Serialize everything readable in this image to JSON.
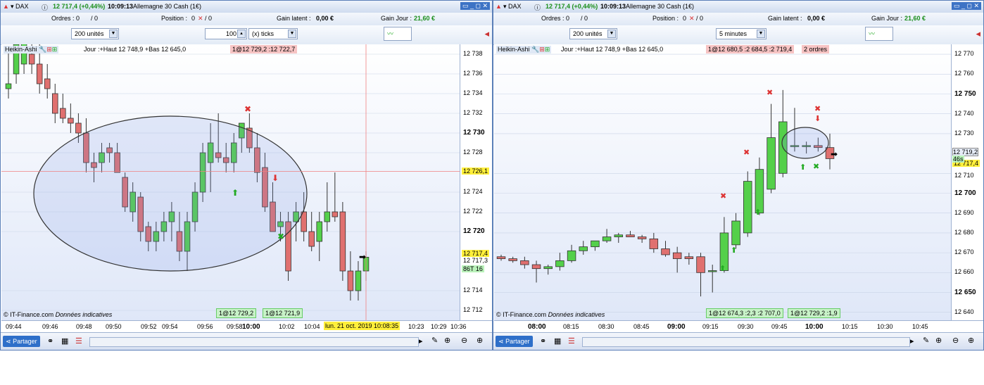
{
  "left": {
    "title": {
      "menu": "▾ DAX",
      "price": "12 717,4 (+0,44%)",
      "time": "10:09:13",
      "instrument": "Allemagne 30 Cash (1€)"
    },
    "info": {
      "orders": "Ordres : 0",
      "orders_count": "/ 0",
      "position": "Position :",
      "position_val": "0",
      "position_count": "/ 0",
      "gain_latent": "Gain latent :",
      "gain_latent_val": "0,00 €",
      "gain_jour": "Gain Jour :",
      "gain_jour_val": "21,60 €"
    },
    "toolbar": {
      "units": "200 unités",
      "ticks_value": "100",
      "ticks_mode": "(x) ticks"
    },
    "header": {
      "indicator": "Heikin-Ashi",
      "hilo": "Jour :+Haut 12 748,9 +Bas 12 645,0",
      "order_tag": "1@12 729,2 :12 722,7"
    },
    "yaxis": [
      {
        "v": "12 738",
        "b": false
      },
      {
        "v": "12 736",
        "b": false
      },
      {
        "v": "12 734",
        "b": false
      },
      {
        "v": "12 732",
        "b": false
      },
      {
        "v": "12 730",
        "b": true
      },
      {
        "v": "12 728",
        "b": false
      },
      {
        "v": "12 726,1",
        "b": false
      },
      {
        "v": "12 724",
        "b": false
      },
      {
        "v": "12 722",
        "b": false
      },
      {
        "v": "12 720",
        "b": true
      },
      {
        "v": "12 717,4",
        "b": false
      },
      {
        "v": "12 717,3",
        "b": false
      },
      {
        "v": "86T",
        "b": false
      },
      {
        "v": "12 714",
        "b": false
      },
      {
        "v": "12 712",
        "b": false
      }
    ],
    "tag_86_extra": "16",
    "xaxis": [
      {
        "t": "09:44",
        "b": false
      },
      {
        "t": "09:46",
        "b": false
      },
      {
        "t": "09:48",
        "b": false
      },
      {
        "t": "09:50",
        "b": false
      },
      {
        "t": "09:52",
        "b": false
      },
      {
        "t": "09:54",
        "b": false
      },
      {
        "t": "09:56",
        "b": false
      },
      {
        "t": "09:58",
        "b": false
      },
      {
        "t": "10:00",
        "b": true
      },
      {
        "t": "10:02",
        "b": false
      },
      {
        "t": "10:04",
        "b": false
      },
      {
        "t": "6",
        "b": false
      },
      {
        "t": "10:23",
        "b": false
      },
      {
        "t": "10:29",
        "b": false
      },
      {
        "t": "10:36",
        "b": false
      }
    ],
    "cursor_date": "lun. 21 oct. 2019 10:08:35",
    "watermark": "© IT-Finance.com",
    "watermark_it": "Données indicatives",
    "pills": [
      "1@12 729,2",
      "1@12 721,9"
    ],
    "share": "Partager",
    "chart_data": {
      "type": "candlestick",
      "ylim": [
        12711,
        12739
      ],
      "candles": [
        [
          12734.5,
          12738.5,
          12733.5,
          12735
        ],
        [
          12736,
          12740,
          12735,
          12739
        ],
        [
          12737,
          12740,
          12736,
          12739.5
        ],
        [
          12738,
          12740,
          12736,
          12737
        ],
        [
          12737,
          12739,
          12734,
          12735
        ],
        [
          12735.5,
          12737,
          12733.5,
          12734.5
        ],
        [
          12734,
          12735,
          12731,
          12732
        ],
        [
          12732.5,
          12734,
          12731,
          12731.5
        ],
        [
          12731.5,
          12733,
          12730,
          12731
        ],
        [
          12731,
          12732,
          12729,
          12730
        ],
        [
          12730,
          12731.5,
          12726,
          12727
        ],
        [
          12727,
          12728,
          12725,
          12726.5
        ],
        [
          12727,
          12729,
          12726,
          12728
        ],
        [
          12728.5,
          12729,
          12727,
          12728
        ],
        [
          12728,
          12729,
          12726,
          12726
        ],
        [
          12725.5,
          12726,
          12722,
          12722.5
        ],
        [
          12722,
          12725,
          12721,
          12724
        ],
        [
          12723.5,
          12724,
          12719,
          12720
        ],
        [
          12720.5,
          12721,
          12718,
          12719
        ],
        [
          12719,
          12721,
          12718,
          12720
        ],
        [
          12720,
          12722,
          12719,
          12721
        ],
        [
          12721,
          12723,
          12719,
          12722
        ],
        [
          12720,
          12722,
          12717,
          12718
        ],
        [
          12718,
          12722,
          12716,
          12721
        ],
        [
          12721,
          12725,
          12720,
          12724
        ],
        [
          12724,
          12729,
          12723,
          12728
        ],
        [
          12727,
          12731,
          12724,
          12729
        ],
        [
          12728,
          12732,
          12727,
          12727.5
        ],
        [
          12727.5,
          12729,
          12726,
          12727
        ],
        [
          12727,
          12730,
          12726,
          12729
        ],
        [
          12729.5,
          12731,
          12728,
          12731
        ],
        [
          12730.5,
          12732,
          12728,
          12728.5
        ],
        [
          12728.5,
          12730,
          12725,
          12726
        ],
        [
          12726.5,
          12728,
          12722,
          12722.5
        ],
        [
          12723,
          12725,
          12721,
          12720
        ],
        [
          12720.5,
          12722,
          12719,
          12721
        ],
        [
          12721,
          12722,
          12715,
          12716
        ],
        [
          12721,
          12723,
          12719,
          12722
        ],
        [
          12722,
          12724,
          12719,
          12720
        ],
        [
          12720,
          12722,
          12718,
          12718.5
        ],
        [
          12719,
          12722,
          12717,
          12721
        ],
        [
          12721,
          12725,
          12720,
          12722
        ],
        [
          12722,
          12726,
          12721,
          12721.5
        ],
        [
          12722,
          12723,
          12715,
          12716
        ],
        [
          12716,
          12718,
          12713,
          12714
        ],
        [
          12714,
          12717,
          12713,
          12716
        ],
        [
          12716,
          12718,
          12715,
          12717.4
        ]
      ]
    }
  },
  "right": {
    "title": {
      "menu": "▾ DAX",
      "price": "12 717,4 (+0,44%)",
      "time": "10:09:13",
      "instrument": "Allemagne 30 Cash (1€)"
    },
    "info": {
      "orders": "Ordres : 0",
      "orders_count": "/ 0",
      "position": "Position :",
      "position_val": "0",
      "position_count": "/ 0",
      "gain_latent": "Gain latent :",
      "gain_latent_val": "0,00 €",
      "gain_jour": "Gain Jour :",
      "gain_jour_val": "21,60 €"
    },
    "toolbar": {
      "units": "200 unités",
      "interval": "5 minutes"
    },
    "header": {
      "indicator": "Heikin-Ashi",
      "hilo": "Jour :+Haut 12 748,9 +Bas 12 645,0",
      "order_tag": "1@12 680,5 :2 684,5 :2 719,4",
      "orders_tag": "2 ordres"
    },
    "yaxis": [
      {
        "v": "12 770",
        "b": false
      },
      {
        "v": "12 760",
        "b": false
      },
      {
        "v": "12 750",
        "b": true
      },
      {
        "v": "12 740",
        "b": false
      },
      {
        "v": "12 730",
        "b": false
      },
      {
        "v": "12 719,2",
        "b": false
      },
      {
        "v": "12 717,4",
        "b": false
      },
      {
        "v": "12 710",
        "b": false
      },
      {
        "v": "12 700",
        "b": true
      },
      {
        "v": "12 690",
        "b": false
      },
      {
        "v": "12 680",
        "b": false
      },
      {
        "v": "12 670",
        "b": false
      },
      {
        "v": "12 660",
        "b": false
      },
      {
        "v": "12 650",
        "b": true
      },
      {
        "v": "12 640",
        "b": false
      }
    ],
    "tag_46": "46s",
    "xaxis": [
      {
        "t": "08:00",
        "b": true
      },
      {
        "t": "08:15",
        "b": false
      },
      {
        "t": "08:30",
        "b": false
      },
      {
        "t": "08:45",
        "b": false
      },
      {
        "t": "09:00",
        "b": true
      },
      {
        "t": "09:15",
        "b": false
      },
      {
        "t": "09:30",
        "b": false
      },
      {
        "t": "09:45",
        "b": false
      },
      {
        "t": "10:00",
        "b": true
      },
      {
        "t": "10:15",
        "b": false
      },
      {
        "t": "10:30",
        "b": false
      },
      {
        "t": "10:45",
        "b": false
      }
    ],
    "watermark": "© IT-Finance.com",
    "watermark_it": "Données indicatives",
    "pills": [
      "1@12 674,3 :2,3 :2 707,0",
      "1@12 729,2 :1,9"
    ],
    "share": "Partager",
    "chart_data": {
      "type": "candlestick",
      "ylim": [
        12636,
        12775
      ],
      "candles": [
        [
          12668,
          12669,
          12666,
          12667
        ],
        [
          12667,
          12668,
          12665,
          12666
        ],
        [
          12666,
          12668,
          12662,
          12664
        ],
        [
          12664,
          12666,
          12655,
          12662
        ],
        [
          12662,
          12664,
          12659,
          12663
        ],
        [
          12663,
          12670,
          12661,
          12666
        ],
        [
          12666,
          12674,
          12665,
          12671
        ],
        [
          12671,
          12676,
          12669,
          12673
        ],
        [
          12673,
          12676,
          12671,
          12676
        ],
        [
          12676,
          12682,
          12675,
          12678
        ],
        [
          12678,
          12680,
          12675,
          12679
        ],
        [
          12679,
          12681,
          12678,
          12678
        ],
        [
          12678,
          12679,
          12675,
          12677
        ],
        [
          12677,
          12680,
          12670,
          12672
        ],
        [
          12672,
          12676,
          12668,
          12669
        ],
        [
          12670,
          12673,
          12660,
          12667
        ],
        [
          12668,
          12670,
          12664,
          12667
        ],
        [
          12668,
          12670,
          12648,
          12660
        ],
        [
          12661,
          12664,
          12650,
          12661
        ],
        [
          12661,
          12688,
          12660,
          12680
        ],
        [
          12674,
          12690,
          12672,
          12686
        ],
        [
          12680,
          12711,
          12678,
          12706
        ],
        [
          12690,
          12718,
          12689,
          12712
        ],
        [
          12702,
          12745,
          12700,
          12728
        ],
        [
          12710,
          12752,
          12708,
          12736
        ],
        [
          12724,
          12743,
          12721,
          12724
        ],
        [
          12724,
          12726,
          12720,
          12724
        ],
        [
          12724,
          12728,
          12721,
          12723
        ],
        [
          12723,
          12730,
          12712,
          12717.4
        ]
      ]
    }
  }
}
